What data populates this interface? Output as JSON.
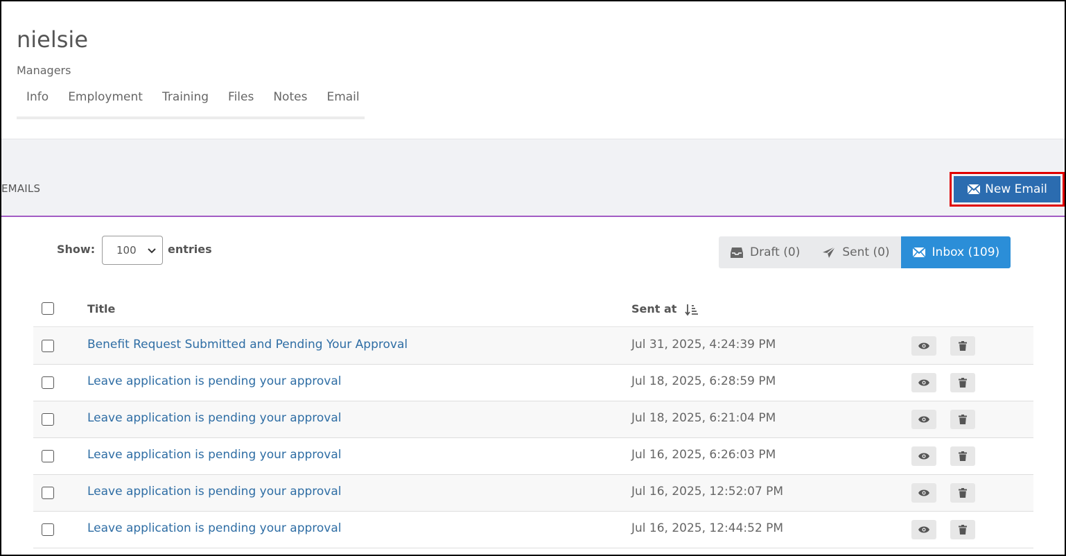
{
  "profile": {
    "name": "nielsie",
    "department": "Managers"
  },
  "tabs": [
    "Info",
    "Employment",
    "Training",
    "Files",
    "Notes",
    "Email"
  ],
  "section": {
    "title": "EMAILS",
    "new_email_label": "New Email"
  },
  "controls": {
    "show_label": "Show:",
    "page_size": "100",
    "entries_label": "entries",
    "filters": [
      {
        "label": "Draft (0)",
        "icon": "inbox-tray-icon",
        "active": false
      },
      {
        "label": "Sent (0)",
        "icon": "paper-plane-icon",
        "active": false
      },
      {
        "label": "Inbox (109)",
        "icon": "envelope-icon",
        "active": true
      }
    ]
  },
  "table": {
    "columns": {
      "title": "Title",
      "sent_at": "Sent at"
    },
    "rows": [
      {
        "title": "Benefit Request Submitted and Pending Your Approval",
        "sent_at": "Jul 31, 2025, 4:24:39 PM"
      },
      {
        "title": "Leave application is pending your approval",
        "sent_at": "Jul 18, 2025, 6:28:59 PM"
      },
      {
        "title": "Leave application is pending your approval",
        "sent_at": "Jul 18, 2025, 6:21:04 PM"
      },
      {
        "title": "Leave application is pending your approval",
        "sent_at": "Jul 16, 2025, 6:26:03 PM"
      },
      {
        "title": "Leave application is pending your approval",
        "sent_at": "Jul 16, 2025, 12:52:07 PM"
      },
      {
        "title": "Leave application is pending your approval",
        "sent_at": "Jul 16, 2025, 12:44:52 PM"
      }
    ]
  },
  "colors": {
    "primary": "#2b6cb0",
    "inbox_active": "#2b8ed8",
    "link": "#2e6da4",
    "highlight": "#e00000",
    "divider": "#a25bc4"
  }
}
